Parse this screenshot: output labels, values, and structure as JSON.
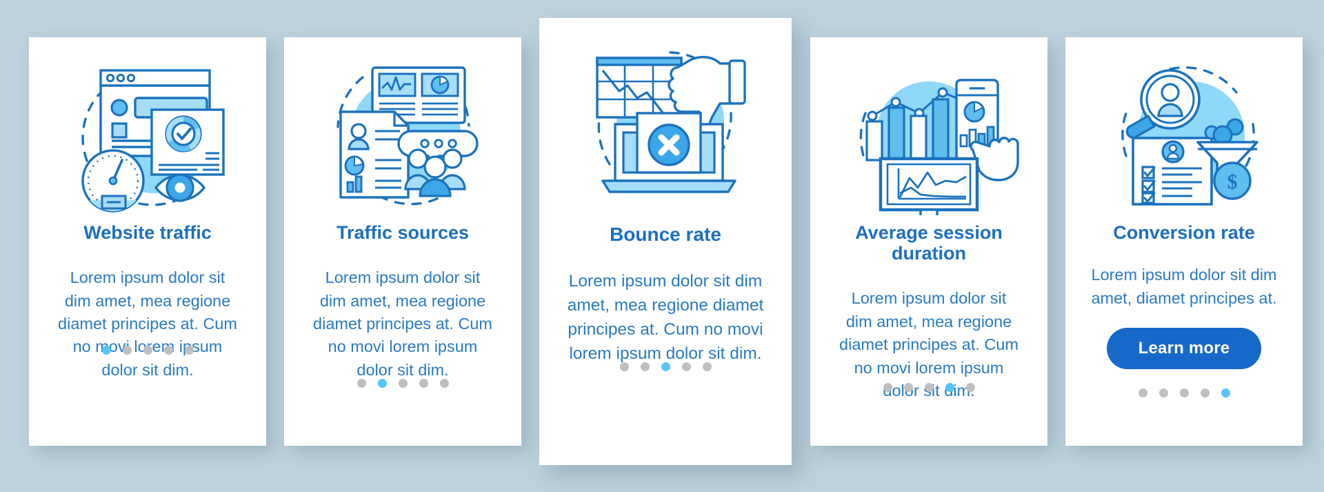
{
  "theme": {
    "page_background": "#bdd2dd",
    "card_background": "#ffffff",
    "title_color": "#1d6fbf",
    "body_color": "#2a7ac2",
    "accent_blue": "#1769c9",
    "dot_active": "#57c5f7",
    "dot_inactive": "#bfbfbf",
    "illustration_line": "#1b72bd",
    "illustration_fill_light": "#a7ddf8",
    "illustration_fill_mid": "#5fbdf0",
    "illustration_blob": "#8ed8f8"
  },
  "screens": [
    {
      "id": "website-traffic",
      "title": "Website traffic",
      "body": "Lorem ipsum dolor sit dim amet, mea regione diamet principes at. Cum no movi lorem ipsum dolor sit dim.",
      "illustration": "browser-window-gauge-eye-icon",
      "dots": {
        "count": 5,
        "active_index": 0
      },
      "cta": null
    },
    {
      "id": "traffic-sources",
      "title": "Traffic sources",
      "body": "Lorem ipsum dolor sit dim amet, mea regione diamet principes at. Cum no movi lorem ipsum dolor sit dim.",
      "illustration": "dashboard-document-people-icon",
      "dots": {
        "count": 5,
        "active_index": 1
      },
      "cta": null
    },
    {
      "id": "bounce-rate",
      "title": "Bounce rate",
      "body": "Lorem ipsum dolor sit dim amet, mea regione diamet principes at. Cum no movi lorem ipsum dolor sit dim.",
      "illustration": "declining-chart-thumbs-down-laptop-icon",
      "dots": {
        "count": 5,
        "active_index": 2
      },
      "cta": null
    },
    {
      "id": "average-session-duration",
      "title": "Average session duration",
      "body": "Lorem ipsum dolor sit dim amet, mea regione diamet principes at. Cum no movi lorem ipsum dolor sit dim.",
      "illustration": "bar-chart-phone-monitor-cursor-icon",
      "dots": {
        "count": 5,
        "active_index": 3
      },
      "cta": null
    },
    {
      "id": "conversion-rate",
      "title": "Conversion rate",
      "body": "Lorem ipsum dolor sit dim amet, diamet principes at.",
      "illustration": "magnifier-checklist-funnel-coin-icon",
      "dots": {
        "count": 5,
        "active_index": 4
      },
      "cta": {
        "label": "Learn more"
      }
    }
  ]
}
